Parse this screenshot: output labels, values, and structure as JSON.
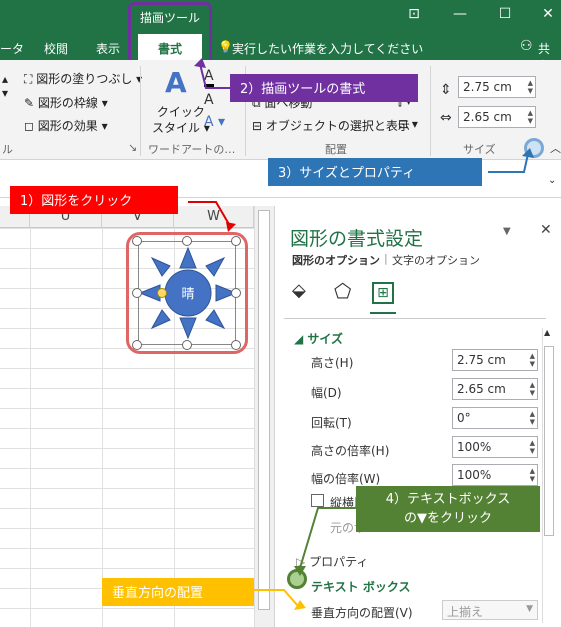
{
  "titlebar": {
    "context_tab": "描画ツール",
    "window_icons": [
      "restore-ribbon-icon",
      "minimize-icon",
      "maximize-icon",
      "close-icon"
    ]
  },
  "tabs": {
    "partial_left": "ータ",
    "items": [
      "校閲",
      "表示",
      "書式"
    ],
    "search_hint": "実行したい作業を入力してください",
    "share": "共有"
  },
  "ribbon": {
    "shape_fill": "図形の塗りつぶし",
    "shape_outline": "図形の枠線",
    "shape_effects": "図形の効果",
    "quick_style_line1": "クイック",
    "quick_style_line2": "スタイル",
    "wordart_group": "ワードアートの…",
    "partial_move": "面へ移動",
    "select_objects": "オブジェクトの選択と表示",
    "arrange_group": "配置",
    "size_group": "サイズ",
    "height_value": "2.75 cm",
    "width_value": "2.65 cm",
    "partial_group_left": "ル"
  },
  "grid": {
    "columns": [
      "U",
      "V",
      "W"
    ],
    "shape_text": "晴"
  },
  "pane": {
    "title": "図形の書式設定",
    "tab_shape": "図形のオプション",
    "tab_text": "文字のオプション",
    "section_size": "サイズ",
    "rows": [
      {
        "label": "高さ(H)",
        "value": "2.75 cm"
      },
      {
        "label": "幅(D)",
        "value": "2.65 cm"
      },
      {
        "label": "回転(T)",
        "value": "0°"
      },
      {
        "label": "高さの倍率(H)",
        "value": "100%"
      },
      {
        "label": "幅の倍率(W)",
        "value": "100%"
      }
    ],
    "lock_aspect": "縦横比",
    "original_size": "元のサ",
    "section_properties": "プロパティ",
    "section_textbox": "テキスト ボックス",
    "vertical_align_label": "垂直方向の配置(V)",
    "vertical_align_value": "上揃え"
  },
  "callouts": {
    "c1": "1）図形をクリック",
    "c2": "2）描画ツールの書式",
    "c3": "3）サイズとプロパティ",
    "c4_line1": "4）テキストボックス",
    "c4_line2": "の▼をクリック",
    "c5": "垂直方向の配置"
  }
}
